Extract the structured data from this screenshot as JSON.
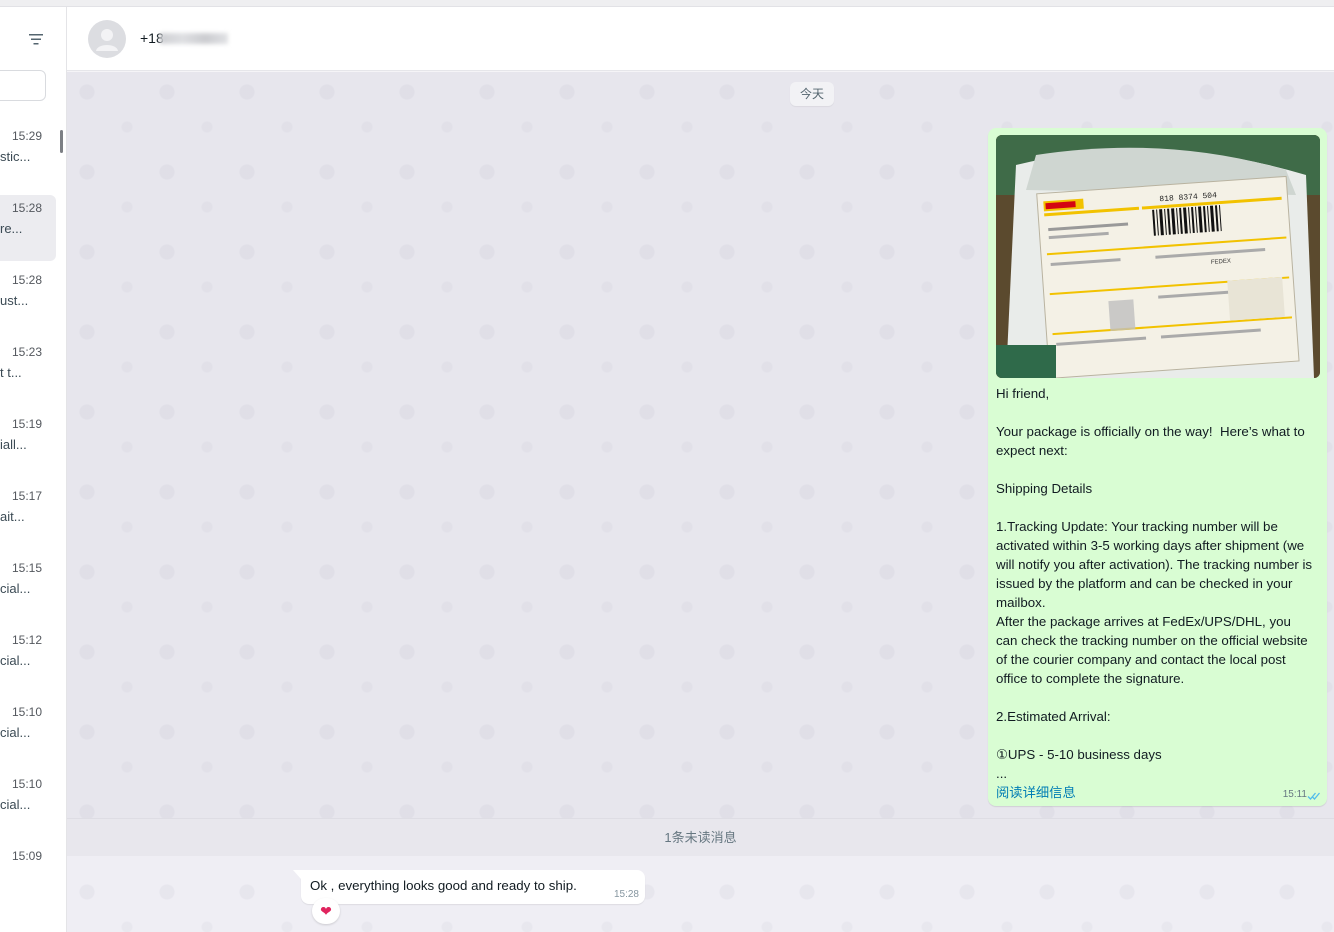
{
  "sidebar": {
    "chats": [
      {
        "time": "15:29",
        "preview": "stic..."
      },
      {
        "time": "15:28",
        "preview": "re...",
        "active": true
      },
      {
        "time": "15:28",
        "preview": "ust..."
      },
      {
        "time": "15:23",
        "preview": "t t..."
      },
      {
        "time": "15:19",
        "preview": "iall..."
      },
      {
        "time": "15:17",
        "preview": "ait..."
      },
      {
        "time": "15:15",
        "preview": "cial..."
      },
      {
        "time": "15:12",
        "preview": "cial..."
      },
      {
        "time": "15:10",
        "preview": "cial..."
      },
      {
        "time": "15:10",
        "preview": "cial..."
      },
      {
        "time": "15:09",
        "preview": ""
      }
    ]
  },
  "header": {
    "contact_name": "+18"
  },
  "conversation": {
    "date_divider": "今天",
    "outgoing": {
      "text": "Hi friend,\n\nYour package is officially on the way!  Here’s what to expect next:\n\nShipping Details\n\n1.Tracking Update: Your tracking number will be activated within 3-5 working days after shipment (we will notify you after activation). The tracking number is issued by the platform and can be checked in your mailbox.\nAfter the package arrives at FedEx/UPS/DHL, you can check the tracking number on the official website of the courier company and contact the local post office to complete the signature.\n\n2.Estimated Arrival:\n\n①UPS - 5-10 business days\n...",
      "read_more": "阅读详细信息",
      "time": "15:11",
      "photo_label": "shipping-label-photo",
      "photo_text": {
        "tracking": "818 8374 504",
        "carrier": "DHL",
        "fedex": "FEDEX"
      }
    },
    "unread_divider": "1条未读消息",
    "incoming": {
      "text": "Ok , everything looks good and ready to ship.",
      "time": "15:28",
      "reaction": "❤"
    }
  },
  "colors": {
    "outgoing_bubble": "#d9fdd3",
    "read_ticks": "#53bdeb",
    "link": "#027eb5",
    "reaction_heart": "#e0245e"
  }
}
